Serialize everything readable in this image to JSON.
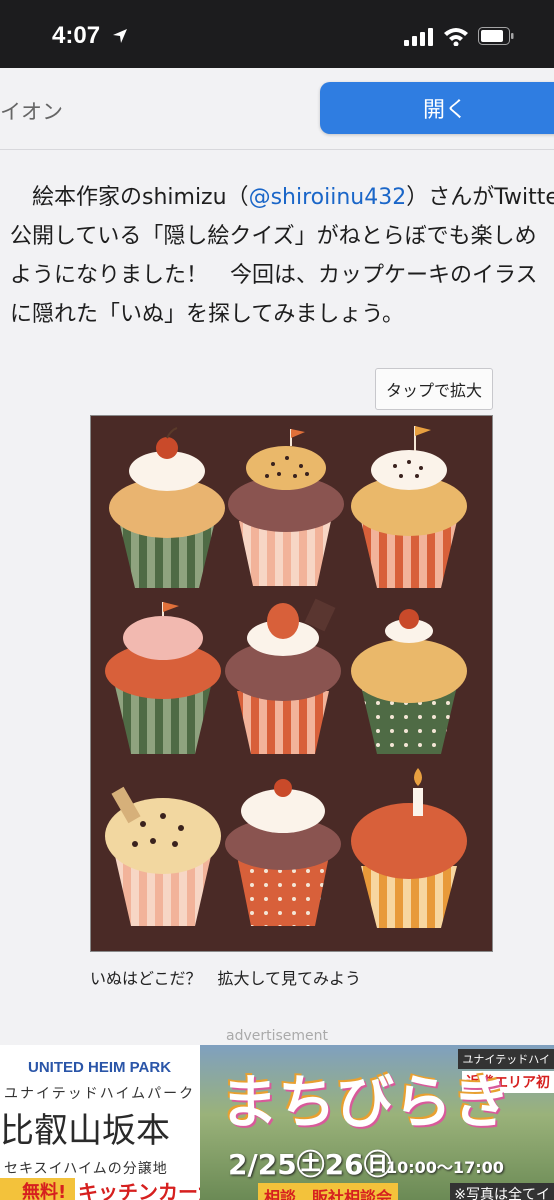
{
  "status_bar": {
    "time": "4:07"
  },
  "app_banner": {
    "cut_text": "",
    "app_name": "イオン",
    "open_label": "開く"
  },
  "article": {
    "line1_prefix": "絵本作家のshimizu（",
    "mention": "@shiroiinu432",
    "line1_suffix": "）さんがTwitter",
    "line2": "公開している「隠し絵クイズ」がねとらぼでも楽しめ",
    "line3": "ようになりました！　今回は、カップケーキのイラス",
    "line4": "に隠れた「いぬ」を探してみましょう。"
  },
  "zoom_button": {
    "label": "タップで拡大"
  },
  "caption": "いぬはどこだ？　拡大して見てみよう",
  "ad": {
    "label": "advertisement",
    "left": {
      "brand": "UNITED HEIM PARK",
      "brand_kana": "ユナイテッドハイムパーク",
      "place": "比叡山坂本",
      "sub": "セキスイハイムの分譲地",
      "free": "無料!",
      "kitchen": "キッチンカーが"
    },
    "right": {
      "small": "ユナイテッドハイ",
      "area": "近畿エリア初",
      "title": "まちびらき",
      "date": "2/25㊏26㊐",
      "time": "10:00〜17:00",
      "badge": "相談　販社相談会",
      "photo_note": "※写真は全てイ"
    }
  },
  "colors": {
    "status_bar_bg": "#1c1c1e",
    "open_button": "#2f7de1",
    "mention": "#1a66c8",
    "illustration_bg": "#4a2a26"
  },
  "icons": [
    "location-arrow-icon",
    "signal-icon",
    "wifi-icon",
    "battery-icon"
  ]
}
